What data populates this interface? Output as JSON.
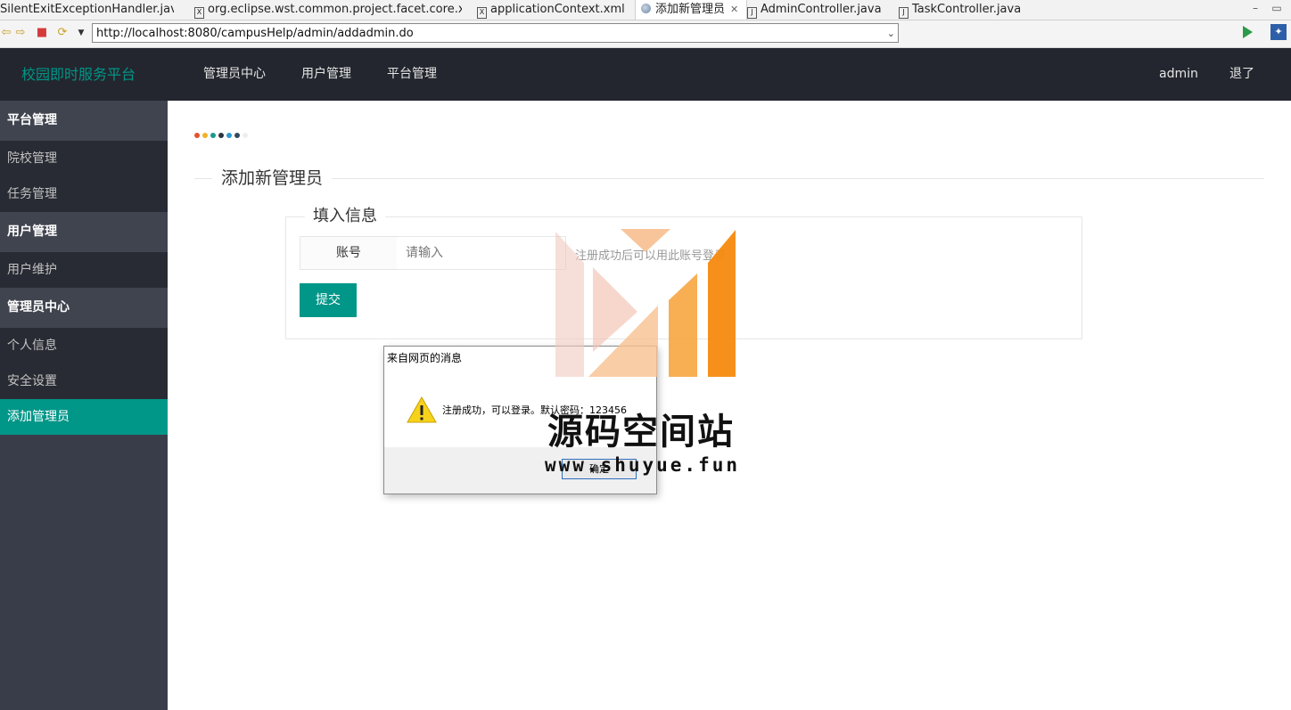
{
  "ide_tabs": [
    {
      "label": "SilentExitExceptionHandler.java",
      "icon": "java-file-icon",
      "active": false
    },
    {
      "label": "org.eclipse.wst.common.project.facet.core.xml",
      "icon": "xml-file-icon",
      "active": false
    },
    {
      "label": "applicationContext.xml",
      "icon": "xml-file-icon",
      "active": false
    },
    {
      "label": "添加新管理员",
      "icon": "browser-globe-icon",
      "active": true
    },
    {
      "label": "AdminController.java",
      "icon": "java-file-icon",
      "active": false
    },
    {
      "label": "TaskController.java",
      "icon": "java-file-icon",
      "active": false
    }
  ],
  "browser": {
    "url": "http://localhost:8080/campusHelp/admin/addadmin.do"
  },
  "header": {
    "logo": "校园即时服务平台",
    "nav": [
      "管理员中心",
      "用户管理",
      "平台管理"
    ],
    "user": "admin",
    "logout": "退了"
  },
  "sidebar": {
    "groups": [
      {
        "title": "平台管理",
        "items": [
          "院校管理",
          "任务管理"
        ]
      },
      {
        "title": "用户管理",
        "items": [
          "用户维护"
        ]
      },
      {
        "title": "管理员中心",
        "items": [
          "个人信息",
          "安全设置",
          "添加管理员"
        ]
      }
    ],
    "active_item": "添加管理员"
  },
  "main": {
    "dot_colors": [
      "#e2542f",
      "#f2b227",
      "#1a9a8c",
      "#2e3440",
      "#2a9ad6",
      "#34495e",
      "#eeeeee"
    ],
    "section_title": "添加新管理员",
    "form": {
      "legend": "填入信息",
      "account_label": "账号",
      "account_placeholder": "请输入",
      "hint": "注册成功后可以用此账号登录",
      "submit_label": "提交"
    }
  },
  "dialog": {
    "title": "来自网页的消息",
    "message": "注册成功，可以登录。默认密码：123456",
    "ok_label": "确定"
  },
  "watermark": {
    "text": "源码空间站",
    "url": "www.shuyue.fun"
  },
  "colors": {
    "accent": "#009688",
    "header_bg": "#23262e",
    "sidebar_bg": "#393d49"
  }
}
